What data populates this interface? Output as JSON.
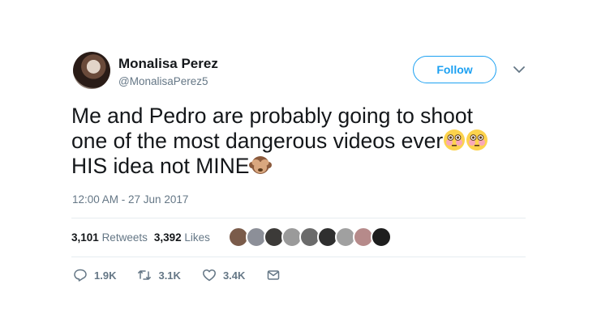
{
  "user": {
    "name": "Monalisa Perez",
    "handle": "@MonalisaPerez5"
  },
  "follow_label": "Follow",
  "tweet": {
    "line1": "Me and Pedro are probably going to shoot",
    "line2": "one of the most dangerous videos ever",
    "line3": "HIS idea not MINE",
    "emojis": [
      "flushed-face",
      "flushed-face",
      "see-no-evil-monkey"
    ]
  },
  "timestamp": "12:00 AM - 27 Jun 2017",
  "stats": {
    "retweets_count": "3,101",
    "retweets_label": "Retweets",
    "likes_count": "3,392",
    "likes_label": "Likes"
  },
  "liker_avatars": 9,
  "actions": {
    "replies": "1.9K",
    "retweets": "3.1K",
    "likes": "3.4K"
  },
  "colors": {
    "accent": "#1da1f2",
    "muted": "#657786"
  }
}
